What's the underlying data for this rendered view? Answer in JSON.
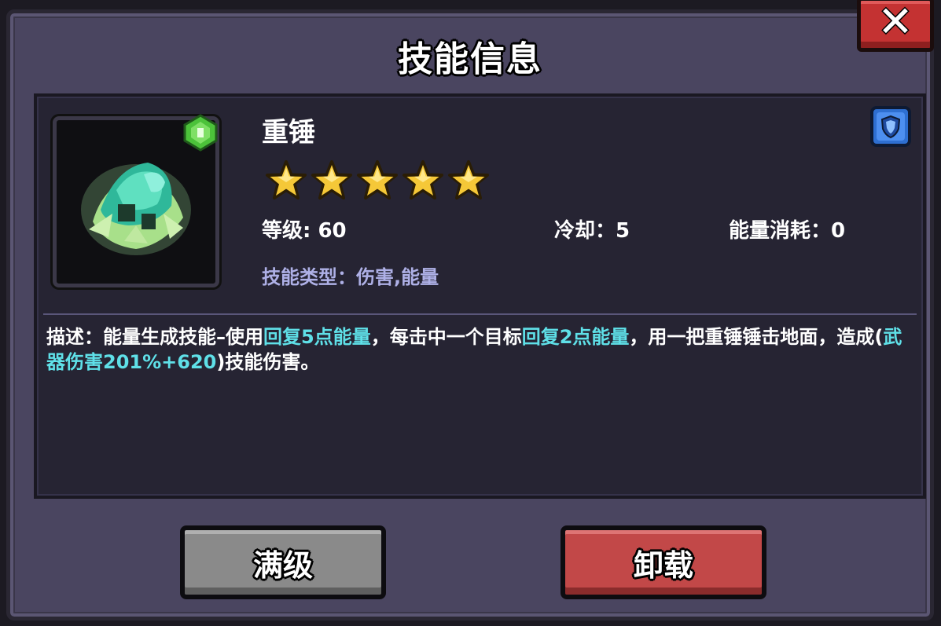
{
  "dialog": {
    "title": "技能信息",
    "close_label": "✕"
  },
  "skill": {
    "name": "重锤",
    "stars": 5,
    "level_label": "等级: 60",
    "cooldown_label": "冷却：5",
    "energy_label": "能量消耗：0",
    "type_label": "技能类型：伤害,能量",
    "icon": "hammer-skill-icon"
  },
  "description": {
    "part1": "描述：能量生成技能–使用",
    "hl1": "回复5点能量",
    "part2": "，每击中一个目标",
    "hl2": "回复2点能量",
    "part3": "，用一把重锤锤击地面，造成(",
    "hl3": "武器伤害201%+620",
    "part4": ")技能伤害。"
  },
  "buttons": {
    "max_level": "满级",
    "unload": "卸载"
  },
  "colors": {
    "highlight": "#5fe0e8",
    "max_button": "#8a8a8a",
    "unload_button": "#c24848",
    "close_button": "#c43232",
    "star": "#f5c838",
    "skill_type_text": "#aeb0e6"
  }
}
